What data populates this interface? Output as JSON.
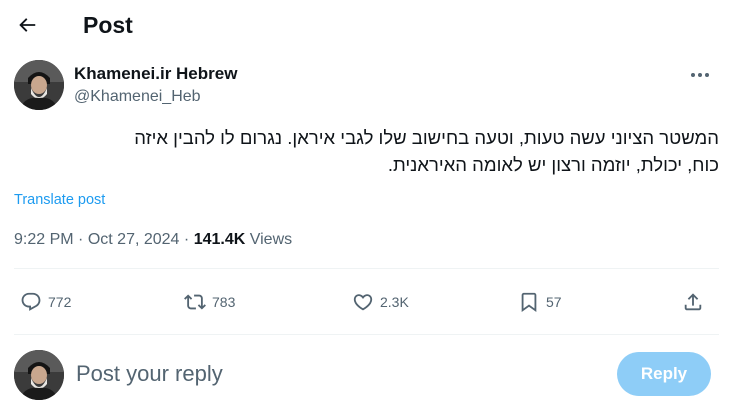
{
  "header": {
    "title": "Post",
    "back_icon": "arrow-left-icon"
  },
  "author": {
    "name": "Khamenei.ir Hebrew",
    "handle": "@Khamenei_Heb",
    "more_icon": "more-horizontal-icon"
  },
  "tweet": {
    "line1": "המשטר הציוני עשה טעות, וטעה בחישוב שלו לגבי איראן. נגרום לו להבין איזה",
    "line2": "כוח, יכולת, יוזמה ורצון יש לאומה האיראנית.",
    "translate_label": "Translate post",
    "time": "9:22 PM",
    "date": "Oct 27, 2024",
    "separator": "·",
    "views_count": "141.4K",
    "views_label": "Views"
  },
  "actions": {
    "replies": "772",
    "reposts": "783",
    "likes": "2.3K",
    "bookmarks": "57"
  },
  "reply": {
    "placeholder": "Post your reply",
    "button_label": "Reply"
  },
  "colors": {
    "text": "#0f1419",
    "secondary": "#536471",
    "link": "#1d9bf0",
    "reply_button_disabled": "#8ecdf7",
    "divider": "#eff3f4"
  }
}
